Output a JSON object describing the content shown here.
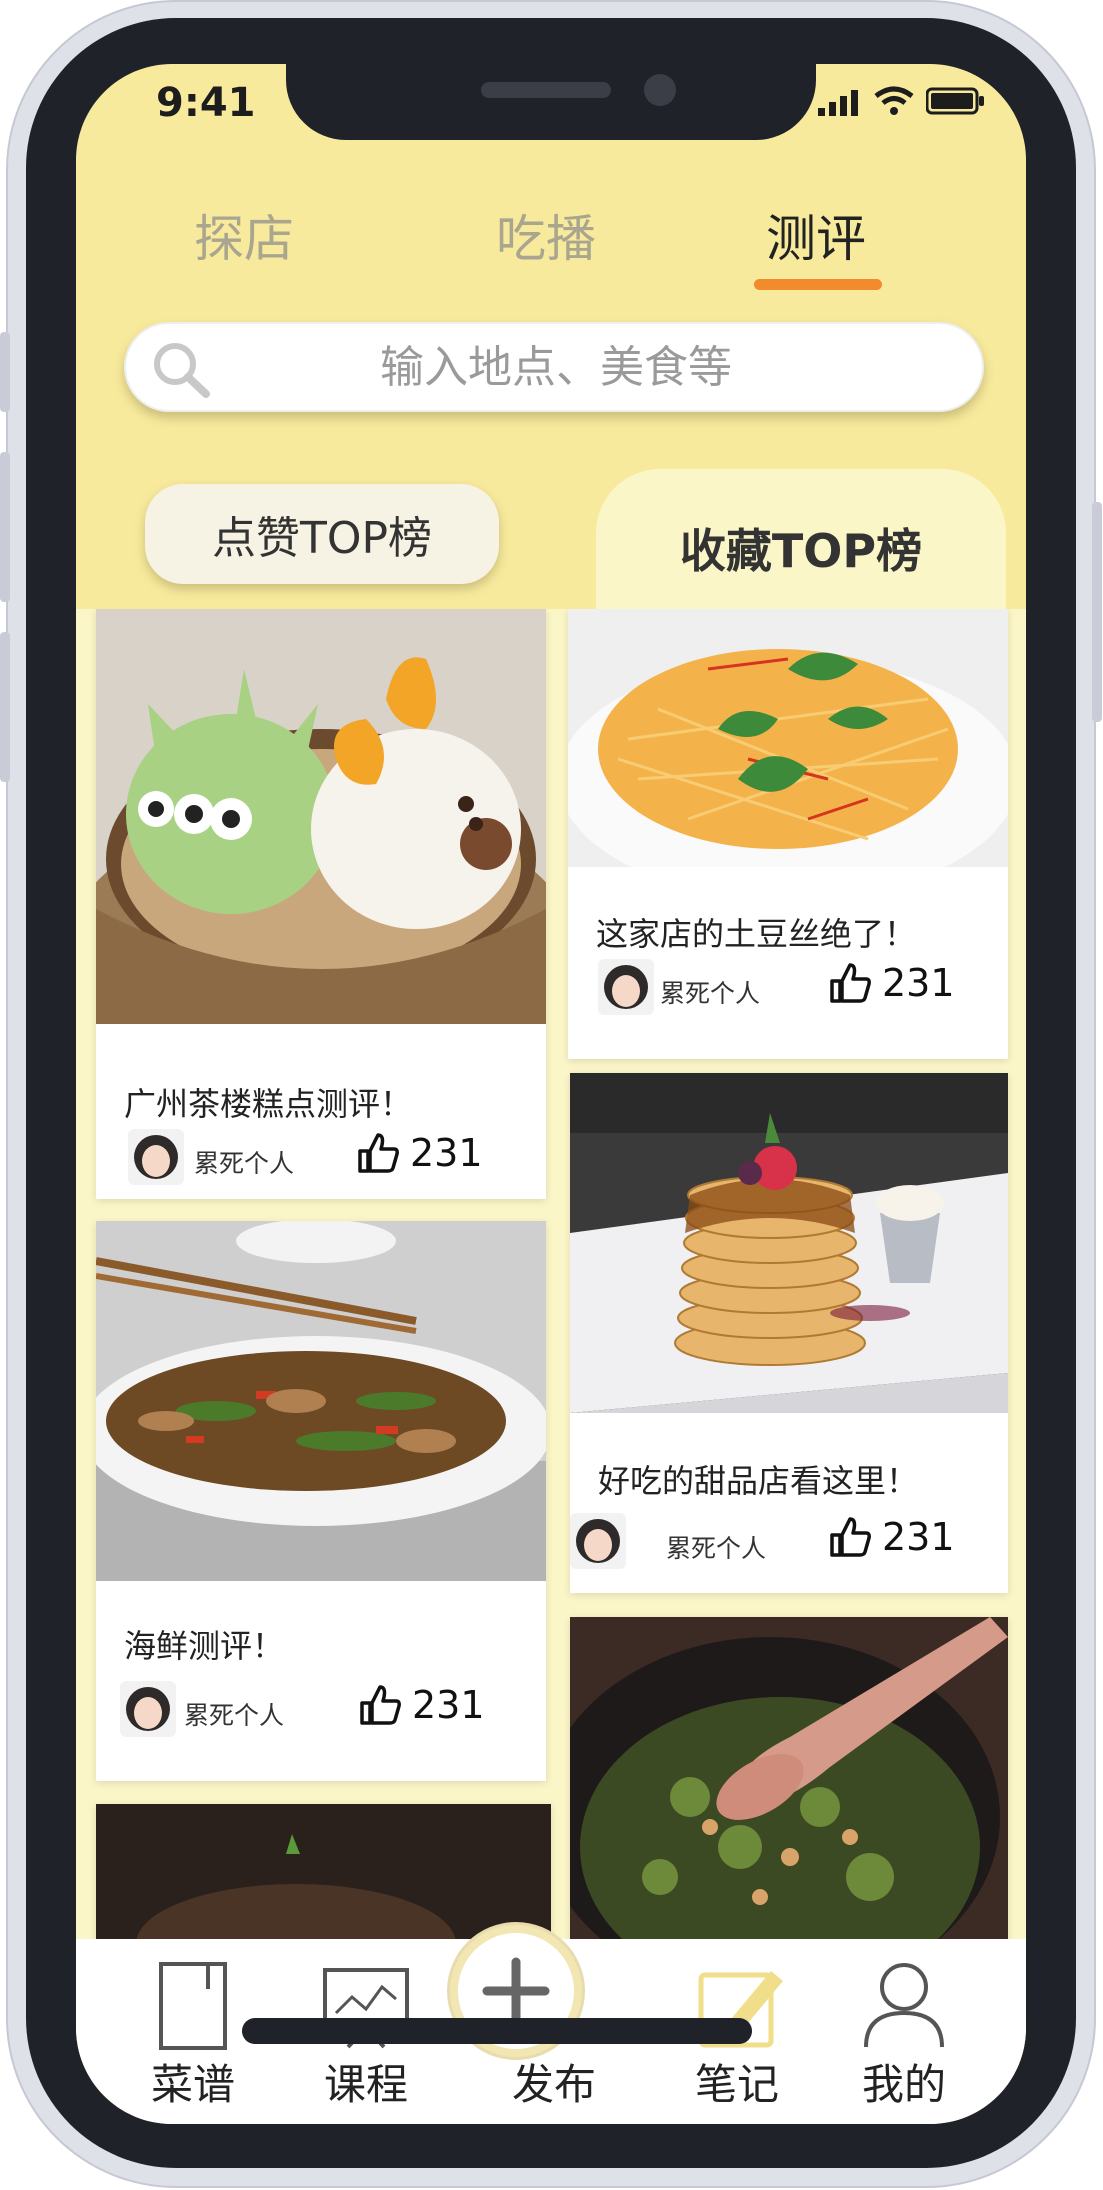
{
  "status_bar": {
    "time": "9:41"
  },
  "top_tabs": [
    {
      "label": "探店",
      "active": false
    },
    {
      "label": "吃播",
      "active": false
    },
    {
      "label": "测评",
      "active": true
    }
  ],
  "search": {
    "placeholder": "输入地点、美食等"
  },
  "ranking": {
    "like_label": "点赞TOP榜",
    "fav_label": "收藏TOP榜",
    "selected": "fav"
  },
  "cards": [
    {
      "title": "广州茶楼糕点测评！",
      "author": "累死个人",
      "likes": "231"
    },
    {
      "title": "这家店的土豆丝绝了！",
      "author": "累死个人",
      "likes": "231"
    },
    {
      "title": "海鲜测评！",
      "author": "累死个人",
      "likes": "231"
    },
    {
      "title": "好吃的甜品店看这里！",
      "author": "累死个人",
      "likes": "231"
    },
    {
      "title": "",
      "author": "",
      "likes": ""
    },
    {
      "title": "",
      "author": "",
      "likes": ""
    }
  ],
  "bottom_nav": [
    {
      "label": "菜谱",
      "icon": "book-icon"
    },
    {
      "label": "课程",
      "icon": "presentation-icon"
    },
    {
      "label": "发布",
      "icon": "plus-icon"
    },
    {
      "label": "笔记",
      "icon": "note-edit-icon"
    },
    {
      "label": "我的",
      "icon": "user-icon"
    }
  ],
  "colors": {
    "accent": "#f28a2e",
    "background": "#f7ea9c",
    "feed_bg": "#fbf6c8"
  }
}
